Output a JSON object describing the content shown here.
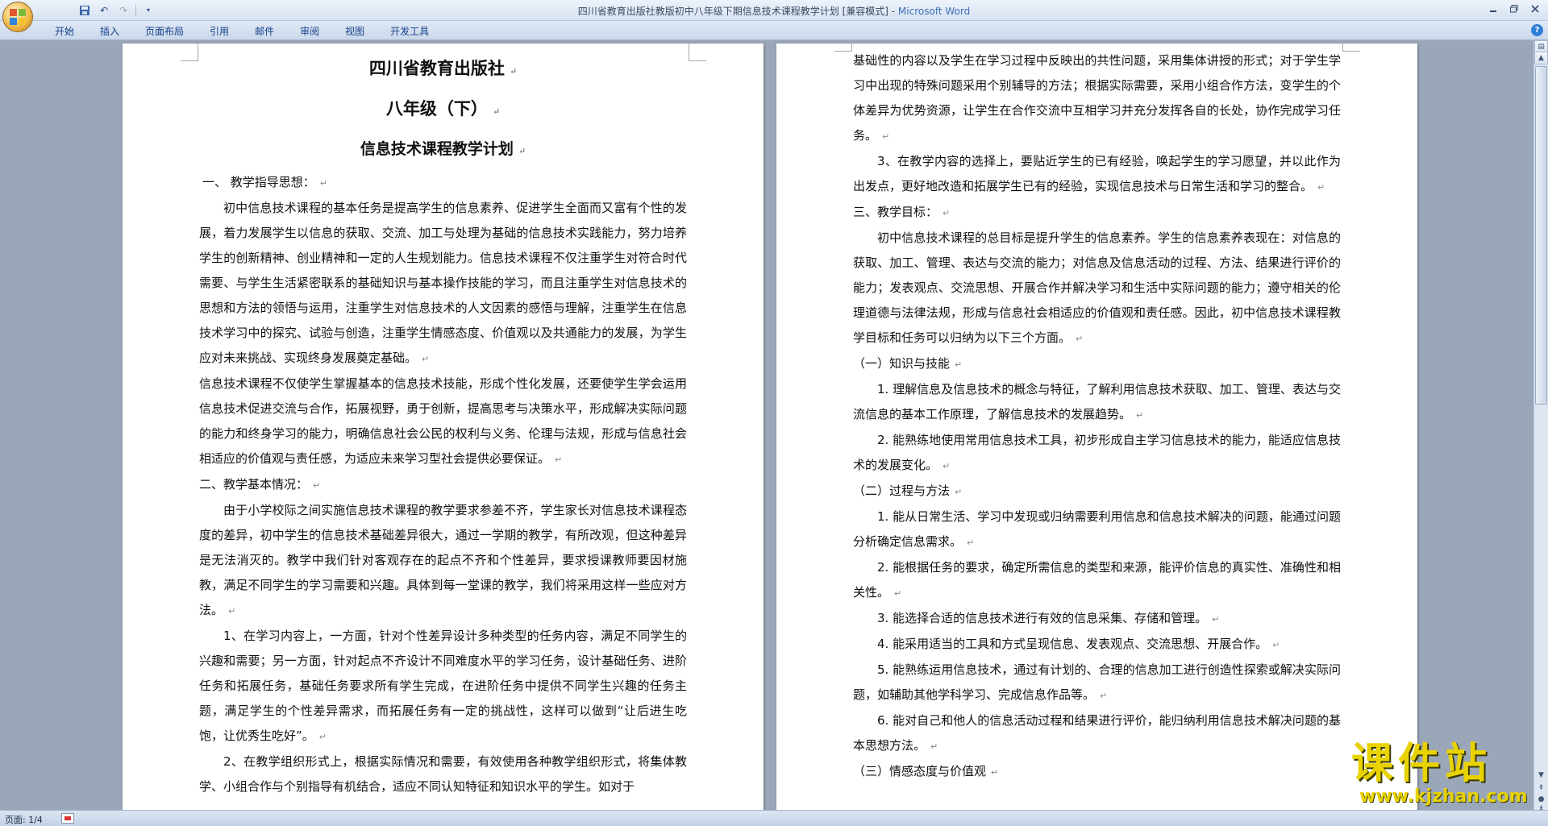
{
  "window": {
    "title": "四川省教育出版社教版初中八年级下期信息技术课程教学计划 [兼容模式] - ",
    "app_name": "Microsoft Word"
  },
  "ribbon": {
    "tabs": [
      "开始",
      "插入",
      "页面布局",
      "引用",
      "邮件",
      "审阅",
      "视图",
      "开发工具"
    ]
  },
  "document": {
    "left_page": {
      "title1": "四川省教育出版社",
      "title2": "八年级（下）",
      "title3": "信息技术课程教学计划",
      "paragraphs": [
        "一、  教学指导思想：",
        "初中信息技术课程的基本任务是提高学生的信息素养、促进学生全面而又富有个性的发展，着力发展学生以信息的获取、交流、加工与处理为基础的信息技术实践能力，努力培养学生的创新精神、创业精神和一定的人生规划能力。信息技术课程不仅注重学生对符合时代需要、与学生生活紧密联系的基础知识与基本操作技能的学习，而且注重学生对信息技术的思想和方法的领悟与运用，注重学生对信息技术的人文因素的感悟与理解，注重学生在信息技术学习中的探究、试验与创造，注重学生情感态度、价值观以及共通能力的发展，为学生应对未来挑战、实现终身发展奠定基础。",
        "信息技术课程不仅使学生掌握基本的信息技术技能，形成个性化发展，还要使学生学会运用信息技术促进交流与合作，拓展视野，勇于创新，提高思考与决策水平，形成解决实际问题的能力和终身学习的能力，明确信息社会公民的权利与义务、伦理与法规，形成与信息社会相适应的价值观与责任感，为适应未来学习型社会提供必要保证。",
        "二、教学基本情况：",
        "由于小学校际之间实施信息技术课程的教学要求参差不齐，学生家长对信息技术课程态度的差异，初中学生的信息技术基础差异很大，通过一学期的教学，有所改观，但这种差异是无法消灭的。教学中我们针对客观存在的起点不齐和个性差异，要求授课教师要因材施教，满足不同学生的学习需要和兴趣。具体到每一堂课的教学，我们将采用这样一些应对方法。",
        "1、在学习内容上，一方面，针对个性差异设计多种类型的任务内容，满足不同学生的兴趣和需要；另一方面，针对起点不齐设计不同难度水平的学习任务，设计基础任务、进阶任务和拓展任务，基础任务要求所有学生完成，在进阶任务中提供不同学生兴趣的任务主题，满足学生的个性差异需求，而拓展任务有一定的挑战性，这样可以做到“让后进生吃饱，让优秀生吃好”。",
        "2、在教学组织形式上，根据实际情况和需要，有效使用各种教学组织形式，将集体教学、小组合作与个别指导有机结合，适应不同认知特征和知识水平的学生。如对于"
      ]
    },
    "right_page": {
      "paragraphs": [
        "基础性的内容以及学生在学习过程中反映出的共性问题，采用集体讲授的形式；对于学生学习中出现的特殊问题采用个别辅导的方法；根据实际需要，采用小组合作方法，变学生的个体差异为优势资源，让学生在合作交流中互相学习并充分发挥各自的长处，协作完成学习任务。",
        "3、在教学内容的选择上，要贴近学生的已有经验，唤起学生的学习愿望，并以此作为出发点，更好地改造和拓展学生已有的经验，实现信息技术与日常生活和学习的整合。",
        "三、教学目标：",
        "初中信息技术课程的总目标是提升学生的信息素养。学生的信息素养表现在：对信息的获取、加工、管理、表达与交流的能力；对信息及信息活动的过程、方法、结果进行评价的能力；发表观点、交流思想、开展合作并解决学习和生活中实际问题的能力；遵守相关的伦理道德与法律法规，形成与信息社会相适应的价值观和责任感。因此，初中信息技术课程教学目标和任务可以归纳为以下三个方面。",
        "（一）知识与技能",
        "1. 理解信息及信息技术的概念与特征，了解利用信息技术获取、加工、管理、表达与交流信息的基本工作原理，了解信息技术的发展趋势。",
        "2. 能熟练地使用常用信息技术工具，初步形成自主学习信息技术的能力，能适应信息技术的发展变化。",
        "（二）过程与方法",
        "1. 能从日常生活、学习中发现或归纳需要利用信息和信息技术解决的问题，能通过问题分析确定信息需求。",
        "2. 能根据任务的要求，确定所需信息的类型和来源，能评价信息的真实性、准确性和相关性。",
        "3. 能选择合适的信息技术进行有效的信息采集、存储和管理。",
        "4. 能采用适当的工具和方式呈现信息、发表观点、交流思想、开展合作。",
        "5. 能熟练运用信息技术，通过有计划的、合理的信息加工进行创造性探索或解决实际问题，如辅助其他学科学习、完成信息作品等。",
        "6. 能对自己和他人的信息活动过程和结果进行评价，能归纳利用信息技术解决问题的基本思想方法。",
        "（三）情感态度与价值观"
      ]
    }
  },
  "statusbar": {
    "page": "页面: 1/4"
  },
  "watermark": {
    "text": "课件站",
    "url": "www.kjzhan.com"
  },
  "colors": {
    "accent": "#15428b",
    "watermark": "#e8d200"
  }
}
